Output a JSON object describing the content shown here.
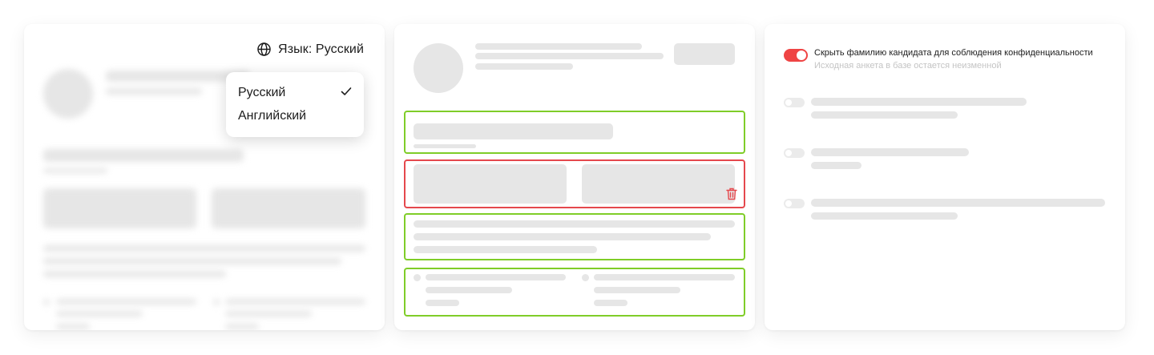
{
  "language": {
    "label": "Язык: Русский",
    "icon": "globe-icon",
    "options": [
      {
        "label": "Русский",
        "selected": true
      },
      {
        "label": "Английский",
        "selected": false
      }
    ]
  },
  "privacy": {
    "toggle_on": true,
    "title": "Скрыть фамилию кандидата для соблюдения конфиденциальности",
    "subtitle": "Исходная анкета в базе остается неизменной"
  },
  "colors": {
    "accent_green": "#7fcd28",
    "accent_red": "#e5484d",
    "toggle_red": "#ef4444",
    "skeleton": "#e6e6e6"
  }
}
